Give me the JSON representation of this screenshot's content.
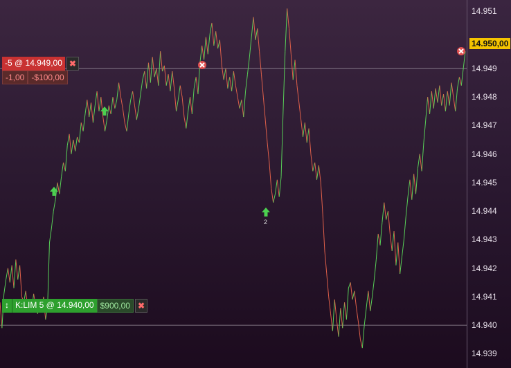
{
  "price_axis": {
    "ticks": [
      "14.951",
      "14.949",
      "14.948",
      "14.947",
      "14.946",
      "14.945",
      "14.944",
      "14.943",
      "14.942",
      "14.941",
      "14.940",
      "14.939"
    ],
    "current_price": "14.950,00",
    "current_price_color": "#f5c400"
  },
  "short_order": {
    "label": "-5 @ 14.949,00",
    "pnl_points": "-1,00",
    "pnl_value": "-$100,00",
    "close_icon": "close-icon",
    "color": "#c83232"
  },
  "long_order": {
    "drag_icon": "up-down-arrow-icon",
    "label": "K:LIM  5 @ 14.940,00",
    "pnl_value": "$900,00",
    "close_icon": "close-icon",
    "color": "#2ea02e"
  },
  "signals": {
    "entry_count_label": "2"
  },
  "colors": {
    "up": "#58d058",
    "down": "#e0604a",
    "level_line": "#c8c0c8"
  },
  "chart_data": {
    "type": "line",
    "price_start": 14940.8,
    "series": [
      {
        "values": [
          14939.9,
          14941.1,
          14941.6,
          14942.0,
          14941.5,
          14942.1,
          14941.3,
          14942.3,
          14941.6,
          14942.1,
          14941.0,
          14940.8,
          14941.2,
          14940.6,
          14940.9,
          14940.5,
          14941.1,
          14940.7,
          14940.4,
          14940.7,
          14940.5,
          14941.0,
          14940.2,
          14940.6,
          14942.9,
          14943.4,
          14944.0,
          14944.4,
          14945.0,
          14944.6,
          14945.2,
          14945.7,
          14945.4,
          14946.3,
          14946.7,
          14946.0,
          14946.5,
          14946.1,
          14946.6,
          14946.4,
          14947.1,
          14946.8,
          14947.4,
          14947.9,
          14947.3,
          14947.8,
          14947.1,
          14947.7,
          14948.2,
          14947.5,
          14948.0,
          14947.3,
          14946.8,
          14947.2,
          14947.7,
          14947.4,
          14948.0,
          14947.6,
          14947.9,
          14948.5,
          14948.0,
          14947.6,
          14947.1,
          14946.8,
          14947.4,
          14947.9,
          14948.2,
          14947.7,
          14947.2,
          14947.6,
          14948.1,
          14948.6,
          14948.9,
          14948.3,
          14949.2,
          14948.5,
          14949.4,
          14948.7,
          14949.0,
          14948.4,
          14949.6,
          14948.9,
          14949.1,
          14948.4,
          14948.8,
          14948.2,
          14948.9,
          14948.3,
          14947.5,
          14947.9,
          14948.4,
          14948.0,
          14947.3,
          14946.9,
          14947.5,
          14948.0,
          14947.4,
          14948.3,
          14948.7,
          14948.1,
          14949.2,
          14949.8,
          14949.3,
          14950.1,
          14949.5,
          14950.2,
          14950.6,
          14949.8,
          14950.3,
          14949.7,
          14950.0,
          14949.1,
          14948.6,
          14949.0,
          14948.3,
          14948.7,
          14948.2,
          14948.9,
          14948.4,
          14948.0,
          14947.6,
          14947.9,
          14947.3,
          14948.2,
          14948.8,
          14949.4,
          14950.1,
          14950.8,
          14950.0,
          14950.4,
          14949.6,
          14948.8,
          14948.0,
          14947.2,
          14946.4,
          14945.7,
          14944.8,
          14944.3,
          14944.6,
          14945.1,
          14944.5,
          14945.2,
          14947.5,
          14949.6,
          14951.1,
          14950.4,
          14949.5,
          14948.6,
          14949.3,
          14948.4,
          14947.8,
          14947.2,
          14946.6,
          14947.1,
          14946.4,
          14946.9,
          14946.0,
          14945.4,
          14945.7,
          14945.1,
          14945.6,
          14945.0,
          14943.9,
          14942.6,
          14941.8,
          14941.0,
          14940.4,
          14939.8,
          14940.9,
          14940.2,
          14939.6,
          14940.6,
          14939.9,
          14940.8,
          14940.2,
          14941.3,
          14941.5,
          14940.9,
          14941.2,
          14940.6,
          14940.1,
          14939.5,
          14939.2,
          14940.0,
          14940.6,
          14941.2,
          14940.5,
          14941.0,
          14941.6,
          14942.3,
          14943.2,
          14942.8,
          14943.6,
          14944.3,
          14943.7,
          14944.0,
          14943.2,
          14942.6,
          14943.3,
          14942.1,
          14942.9,
          14941.8,
          14942.4,
          14943.0,
          14943.8,
          14944.5,
          14945.1,
          14944.4,
          14945.3,
          14944.6,
          14945.5,
          14946.0,
          14945.4,
          14946.4,
          14947.2,
          14948.0,
          14947.4,
          14948.2,
          14947.6,
          14948.3,
          14947.8,
          14948.4,
          14947.7,
          14948.1,
          14947.5,
          14948.2,
          14947.7,
          14948.5,
          14948.0,
          14947.5,
          14948.3,
          14948.7,
          14948.4,
          14949.0,
          14949.6
        ]
      }
    ],
    "ylim": [
      14938.5,
      14951.4
    ],
    "grid": false
  }
}
